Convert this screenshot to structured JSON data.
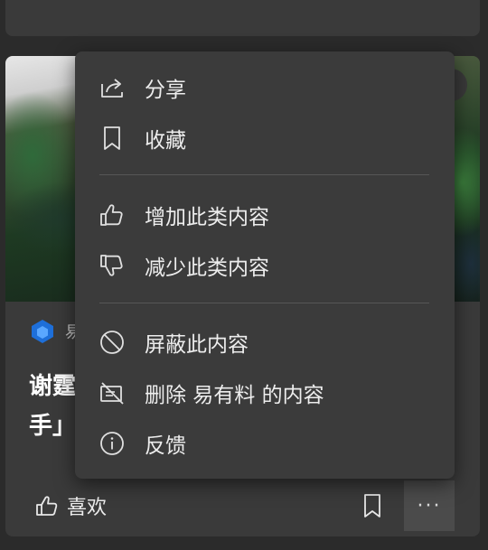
{
  "card": {
    "source_name": "易",
    "headline_line1": "谢霆",
    "headline_line2": "手」",
    "like_label": "喜欢",
    "more_label": "···"
  },
  "menu": {
    "share": "分享",
    "collect": "收藏",
    "more_like_this": "增加此类内容",
    "less_like_this": "减少此类内容",
    "block_content": "屏蔽此内容",
    "delete_source": "删除 易有料 的内容",
    "feedback": "反馈"
  },
  "colors": {
    "background": "#2b2b2b",
    "card": "#3a3a3a",
    "menu": "#3b3b3b",
    "source_logo": "#1e6fd9"
  },
  "icons": [
    "share-icon",
    "bookmark-icon",
    "thumbs-up-icon",
    "thumbs-down-icon",
    "block-icon",
    "delete-source-icon",
    "info-icon"
  ]
}
